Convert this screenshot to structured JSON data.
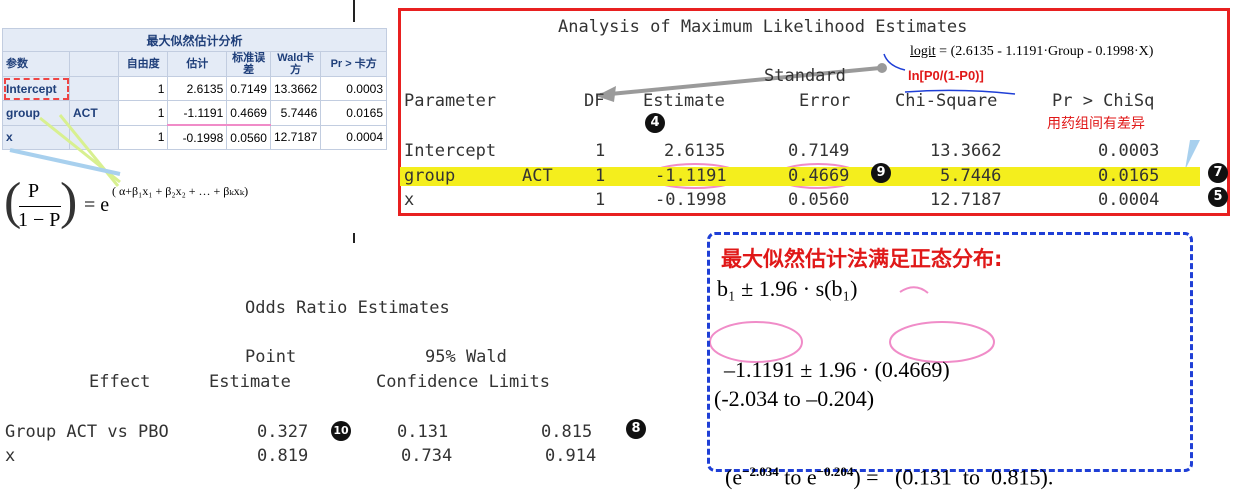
{
  "sas": {
    "title": "最大似然估计分析",
    "headers": [
      "参数",
      "",
      "自由度",
      "估计",
      "标准误差",
      "Wald卡方",
      "Pr > 卡方"
    ],
    "rows": [
      [
        "Intercept",
        "",
        "1",
        "2.6135",
        "0.7149",
        "13.3662",
        "0.0003"
      ],
      [
        "group",
        "ACT",
        "1",
        "-1.1191",
        "0.4669",
        "5.7446",
        "0.0165"
      ],
      [
        "x",
        "",
        "1",
        "-0.1998",
        "0.0560",
        "12.7187",
        "0.0004"
      ]
    ]
  },
  "formula": {
    "numerator": "P",
    "denominator": "1 − P",
    "equals": "= e",
    "exponent": "( α+β₁x₁ + β₂x₂ + … + βₖxₖ)"
  },
  "mle": {
    "title": "Analysis of Maximum Likelihood Estimates",
    "header_top": "Standard",
    "headers": [
      "Parameter",
      "DF",
      "Estimate",
      "Error",
      "Chi-Square",
      "Pr > ChiSq"
    ],
    "rows": [
      [
        "Intercept",
        "",
        "1",
        "2.6135",
        "0.7149",
        "13.3662",
        "0.0003"
      ],
      [
        "group",
        "ACT",
        "1",
        "-1.1191",
        "0.4669",
        "5.7446",
        "0.0165"
      ],
      [
        "x",
        "",
        "1",
        "-0.1998",
        "0.0560",
        "12.7187",
        "0.0004"
      ]
    ],
    "logit_label": "logit",
    "logit_formula": "= (2.6135 - 1.1191·Group - 0.1998·X)",
    "ln_label": "ln[P0/(1-P0)]",
    "note_diff": "用药组间有差异"
  },
  "odds": {
    "title": "Odds Ratio Estimates",
    "h1": [
      "Point",
      "95% Wald"
    ],
    "h2": [
      "Effect",
      "Estimate",
      "Confidence Limits"
    ],
    "rows": [
      [
        "Group ACT vs PBO",
        "0.327",
        "0.131",
        "0.815"
      ],
      [
        "x",
        "0.819",
        "0.734",
        "0.914"
      ]
    ]
  },
  "ci": {
    "heading": "最大似然估计法满足正态分布:",
    "line1": "b₁ ± 1.96 · s(b₁)",
    "line2_a": "–1.1191",
    "line2_b": " ± 1.96 · ",
    "line2_c": "(0.4669)",
    "line3": "(-2.034 to –0.204)",
    "line4_a": "(e",
    "line4_sup1": "−2.034",
    "line4_b": " to e",
    "line4_sup2": "−0.204",
    "line4_c": ") =   (0.131  to  0.815)."
  },
  "badges": {
    "b4": "4",
    "b5": "5",
    "b7": "7",
    "b8": "8",
    "b9": "9",
    "b10": "10"
  },
  "colors": {
    "red_frame": "#e82020",
    "blue_frame": "#1f3fd6",
    "highlight": "#f4ee1d",
    "pink_mark": "#f08cc8",
    "note_red": "#e01818"
  }
}
